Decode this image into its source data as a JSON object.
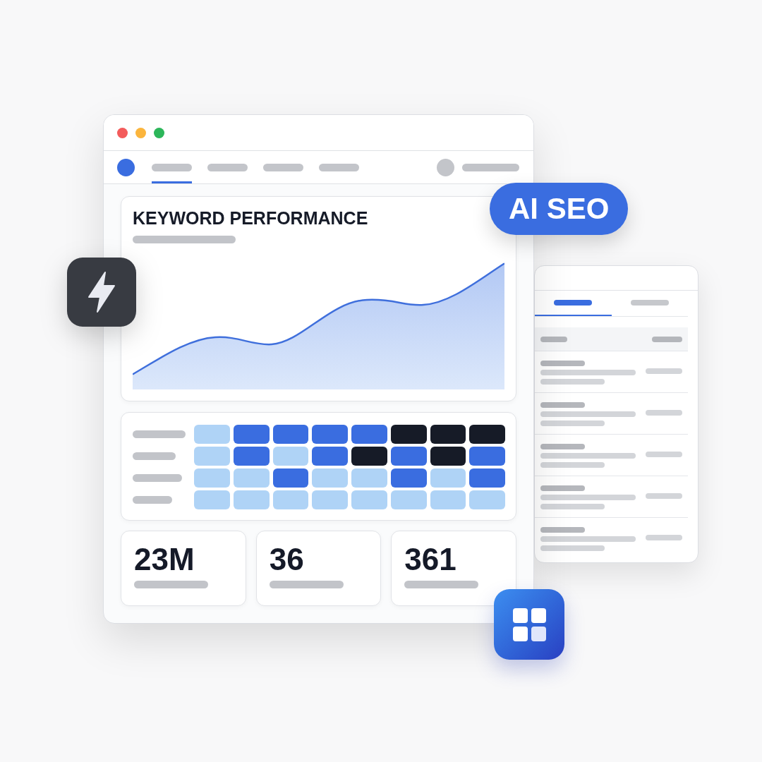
{
  "window": {
    "nav": {
      "tabs": [
        {
          "selected": true
        },
        {
          "selected": false
        },
        {
          "selected": false
        },
        {
          "selected": false
        }
      ]
    },
    "chart_card": {
      "title": "KEYWORD PERFORMANCE"
    },
    "heatmap": {
      "rows": [
        {
          "cells": [
            {
              "color": "#afd3f6"
            },
            {
              "color": "#3a6de0"
            },
            {
              "color": "#3a6de0"
            },
            {
              "color": "#3a6de0"
            },
            {
              "color": "#3a6de0"
            },
            {
              "color": "#161b27"
            },
            {
              "color": "#161b27"
            },
            {
              "color": "#161b27"
            }
          ]
        },
        {
          "cells": [
            {
              "color": "#afd3f6"
            },
            {
              "color": "#3a6de0"
            },
            {
              "color": "#afd3f6"
            },
            {
              "color": "#3a6de0"
            },
            {
              "color": "#161b27"
            },
            {
              "color": "#3a6de0"
            },
            {
              "color": "#161b27"
            },
            {
              "color": "#3a6de0"
            }
          ]
        },
        {
          "cells": [
            {
              "color": "#afd3f6"
            },
            {
              "color": "#afd3f6"
            },
            {
              "color": "#3a6de0"
            },
            {
              "color": "#afd3f6"
            },
            {
              "color": "#afd3f6"
            },
            {
              "color": "#3a6de0"
            },
            {
              "color": "#afd3f6"
            },
            {
              "color": "#3a6de0"
            }
          ]
        },
        {
          "cells": [
            {
              "color": "#afd3f6"
            },
            {
              "color": "#afd3f6"
            },
            {
              "color": "#afd3f6"
            },
            {
              "color": "#afd3f6"
            },
            {
              "color": "#afd3f6"
            },
            {
              "color": "#afd3f6"
            },
            {
              "color": "#afd3f6"
            },
            {
              "color": "#afd3f6"
            }
          ]
        }
      ]
    },
    "stats": [
      {
        "value": "23M"
      },
      {
        "value": "36"
      },
      {
        "value": "361"
      }
    ]
  },
  "badge": {
    "label": "AI SEO"
  },
  "side_panel": {
    "tabs": [
      {
        "selected": true
      },
      {
        "selected": false
      }
    ]
  }
}
